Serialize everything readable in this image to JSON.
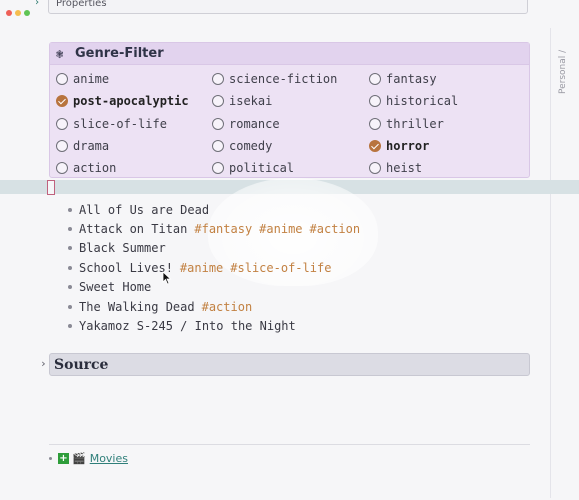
{
  "window": {
    "properties_label": "Properties",
    "breadcrumb": "Personal /"
  },
  "genre_filter": {
    "title": "Genre-Filter",
    "options": [
      {
        "label": "anime",
        "checked": false
      },
      {
        "label": "science-fiction",
        "checked": false
      },
      {
        "label": "fantasy",
        "checked": false
      },
      {
        "label": "post-apocalyptic",
        "checked": true
      },
      {
        "label": "isekai",
        "checked": false
      },
      {
        "label": "historical",
        "checked": false
      },
      {
        "label": "slice-of-life",
        "checked": false
      },
      {
        "label": "romance",
        "checked": false
      },
      {
        "label": "thriller",
        "checked": false
      },
      {
        "label": "drama",
        "checked": false
      },
      {
        "label": "comedy",
        "checked": false
      },
      {
        "label": "horror",
        "checked": true
      },
      {
        "label": "action",
        "checked": false
      },
      {
        "label": "political",
        "checked": false
      },
      {
        "label": "heist",
        "checked": false
      }
    ]
  },
  "results": [
    {
      "title": "All of Us are Dead",
      "tags": []
    },
    {
      "title": "Attack on Titan",
      "tags": [
        "#fantasy",
        "#anime",
        "#action"
      ]
    },
    {
      "title": "Black Summer",
      "tags": []
    },
    {
      "title": "School Lives!",
      "tags": [
        "#anime",
        "#slice-of-life"
      ]
    },
    {
      "title": "Sweet Home",
      "tags": []
    },
    {
      "title": "The Walking Dead",
      "tags": [
        "#action"
      ]
    },
    {
      "title": "Yakamoz S-245 / Into the Night",
      "tags": []
    }
  ],
  "source_section": {
    "title": "Source"
  },
  "footer": {
    "plus": "+",
    "clapper": "🎬",
    "link_label": "Movies"
  },
  "colors": {
    "checked": "#b8743e",
    "tag": "#c28142",
    "filter_bg": "#ede2f4",
    "link": "#2f7f7a"
  }
}
